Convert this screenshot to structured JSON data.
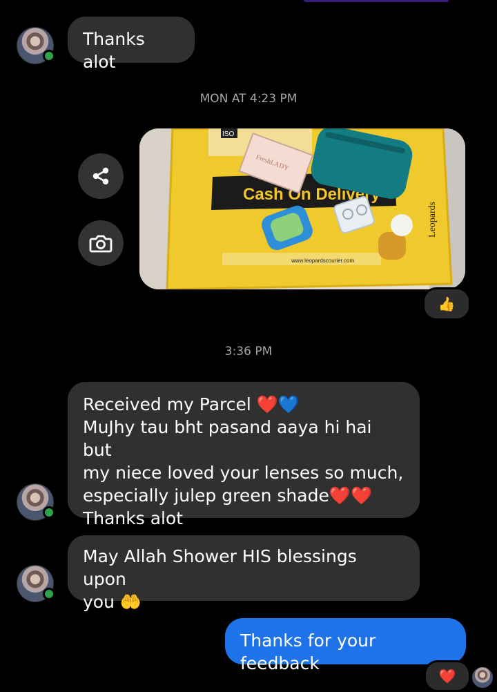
{
  "messages": {
    "m1": "Thanks alot",
    "timestamp1": "MON AT 4:23 PM",
    "timestamp2": "3:36 PM",
    "m2": "Received my Parcel ❤️💙\nMuJhy tau bht pasand aaya hi hai but\nmy niece loved your lenses so much,\nespecially julep green shade❤️❤️\nThanks alot",
    "m3": "May Allah Shower HIS blessings upon\nyou 🤲",
    "m4": "Thanks for your feedback"
  },
  "photo": {
    "banner_text": "Cash On Delivery",
    "badge_text": "ISO",
    "brand_text": "Leopards",
    "box_text": "FreshLADY",
    "website_text": "www.leopardscourier.com"
  },
  "reactions": {
    "photo_reaction": "👍",
    "last_reaction": "❤️"
  },
  "icons": [
    "share-icon",
    "camera-icon"
  ],
  "colors": {
    "incoming_bubble": "#303030",
    "outgoing_bubble": "#1e73e8",
    "online": "#31a24c",
    "background": "#000000"
  }
}
